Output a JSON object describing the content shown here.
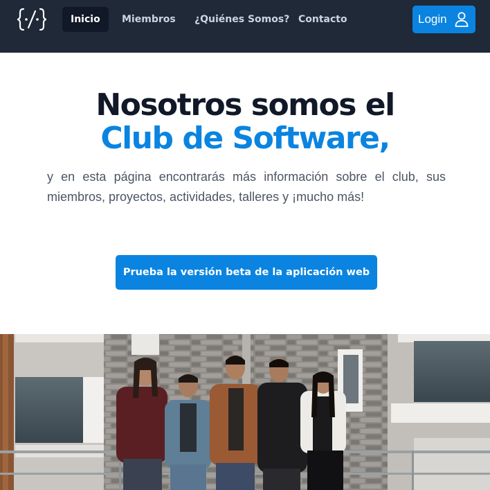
{
  "navbar": {
    "logo_icon": "code-braces-logo-icon",
    "links": [
      {
        "label": "Inicio",
        "active": true
      },
      {
        "label": "Miembros",
        "active": false
      },
      {
        "label": "¿Quiénes Somos?",
        "active": false
      },
      {
        "label": "Contacto",
        "active": false
      }
    ],
    "login_label": "Login",
    "login_icon": "user-icon"
  },
  "hero": {
    "title_line1": "Nosotros somos el",
    "title_line2": "Club de Software,",
    "description": "y en esta página encontrarás más información sobre el club, sus miembros, proyectos, actividades, talleres y ¡mucho más!",
    "cta_label": "Prueba la versión beta de la aplicación web"
  },
  "colors": {
    "navbar_bg": "#1f2937",
    "accent": "#0a84e0",
    "title_dark": "#111827",
    "text_gray": "#4b5563"
  }
}
